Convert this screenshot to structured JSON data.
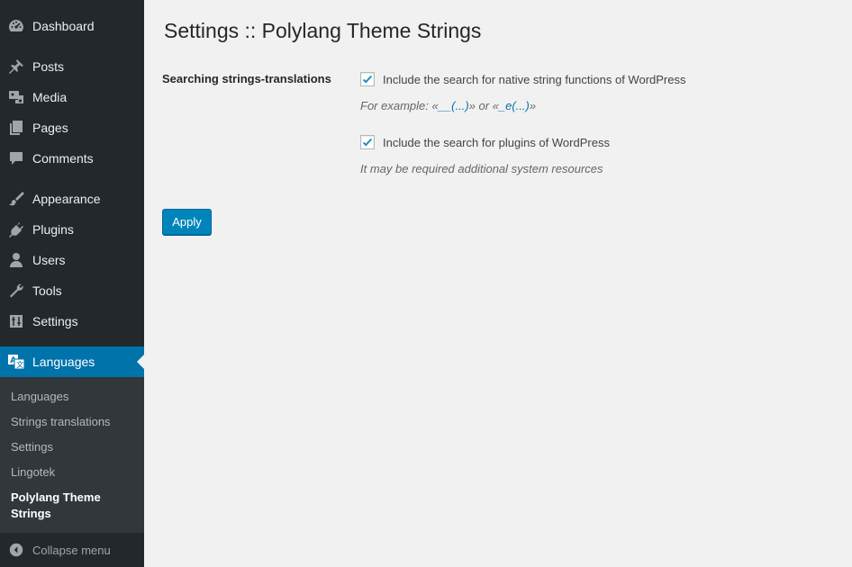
{
  "sidebar": {
    "items": [
      {
        "label": "Dashboard",
        "icon": "dashboard-icon"
      },
      {
        "label": "Posts",
        "icon": "pushpin-icon"
      },
      {
        "label": "Media",
        "icon": "media-icon"
      },
      {
        "label": "Pages",
        "icon": "pages-icon"
      },
      {
        "label": "Comments",
        "icon": "comment-icon"
      },
      {
        "label": "Appearance",
        "icon": "paintbrush-icon"
      },
      {
        "label": "Plugins",
        "icon": "plug-icon"
      },
      {
        "label": "Users",
        "icon": "user-icon"
      },
      {
        "label": "Tools",
        "icon": "wrench-icon"
      },
      {
        "label": "Settings",
        "icon": "sliders-icon"
      },
      {
        "label": "Languages",
        "icon": "translation-icon",
        "active": true
      }
    ],
    "submenu": [
      {
        "label": "Languages"
      },
      {
        "label": "Strings translations"
      },
      {
        "label": "Settings"
      },
      {
        "label": "Lingotek"
      },
      {
        "label": "Polylang Theme Strings",
        "current": true
      }
    ],
    "collapse_label": "Collapse menu"
  },
  "main": {
    "title": "Settings :: Polylang Theme Strings",
    "field_label": "Searching strings-translations",
    "option1": {
      "label": "Include the search for native string functions of WordPress",
      "checked": true,
      "desc_prefix": "For example: «",
      "desc_code1": "__(...)",
      "desc_mid": "» or «",
      "desc_code2": "_e(...)",
      "desc_suffix": "»"
    },
    "option2": {
      "label": "Include the search for plugins of WordPress",
      "checked": true,
      "desc": "It may be required additional system resources"
    },
    "apply_label": "Apply"
  },
  "colors": {
    "sidebar_bg": "#23282d",
    "submenu_bg": "#32373c",
    "accent": "#0073aa",
    "button": "#0085ba",
    "page_bg": "#f1f1f1"
  }
}
